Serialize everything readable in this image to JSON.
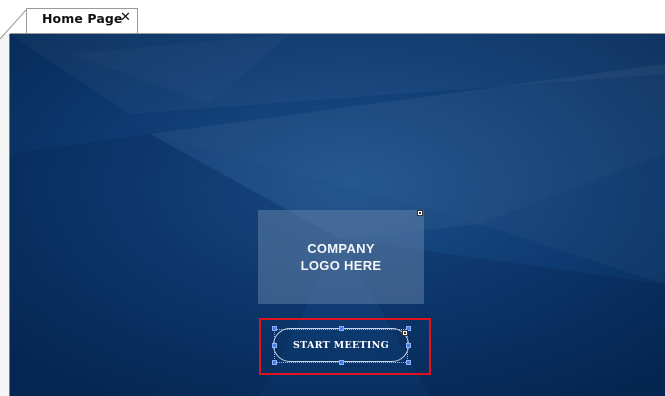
{
  "tabs": [
    {
      "label": "Home Page",
      "close_glyph": "✕",
      "active": true
    }
  ],
  "canvas": {
    "background_color": "#0a3466",
    "logo_placeholder": {
      "text": "COMPANY\nLOGO HERE"
    },
    "start_button": {
      "label": "START MEETING",
      "selected": true
    },
    "selection_highlight_color": "#e0141e",
    "handle_color": "#3e7df2"
  },
  "icons": {
    "tab_close": "close-icon",
    "info_marker": "info-marker-icon"
  }
}
